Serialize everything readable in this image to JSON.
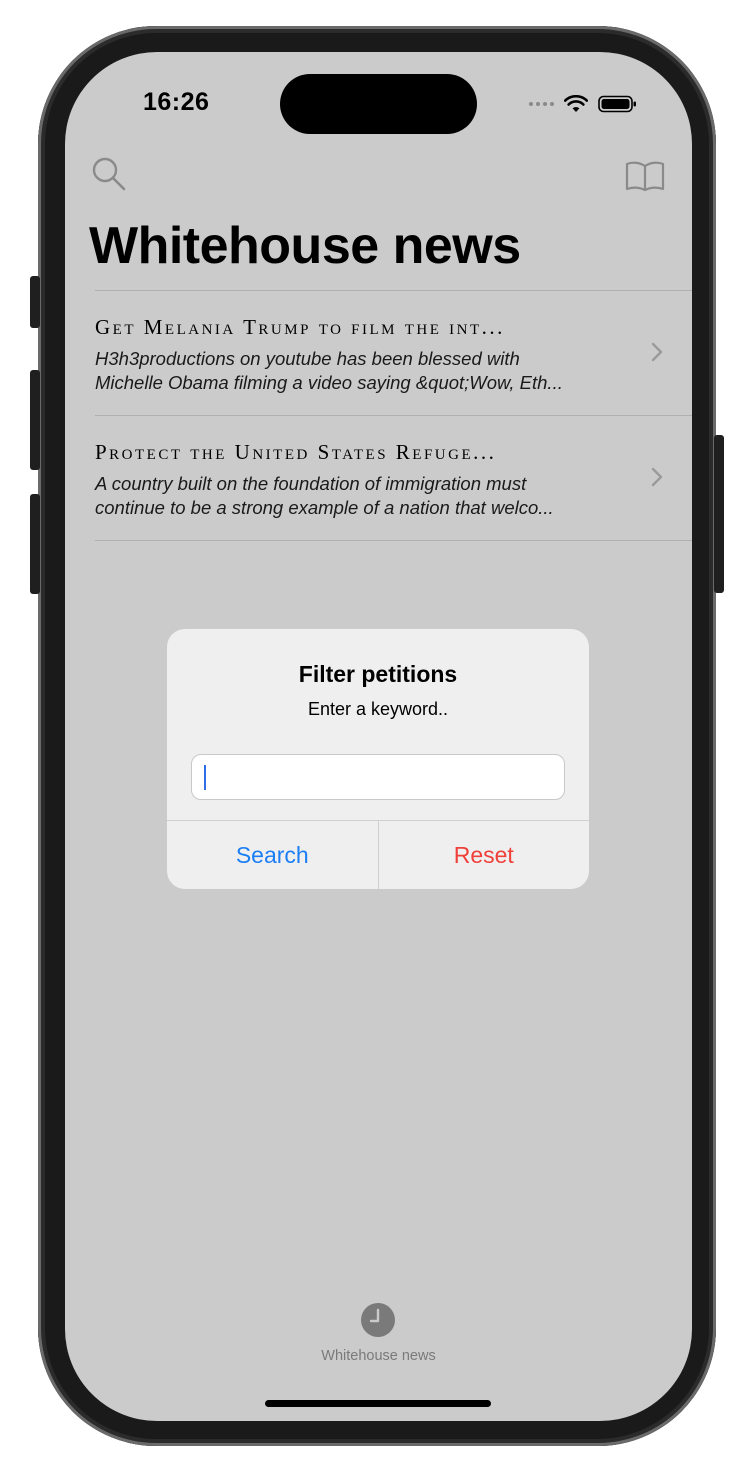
{
  "status_bar": {
    "time": "16:26"
  },
  "nav": {
    "left_icon": "search-icon",
    "right_icon": "book-icon",
    "title": "Whitehouse news"
  },
  "petitions": [
    {
      "title": "Get Melania Trump to film the int...",
      "body_line1": "H3h3productions on youtube has been blessed with",
      "body_line2": "Michelle Obama filming a video saying &quot;Wow, Eth..."
    },
    {
      "title": "Protect the United States Refuge...",
      "body_line1": "A country built on the foundation of immigration must",
      "body_line2": "continue to be a strong example of a nation that welco..."
    }
  ],
  "dialog": {
    "title": "Filter petitions",
    "message": "Enter a keyword..",
    "input_value": "",
    "search_label": "Search",
    "reset_label": "Reset"
  },
  "tab_bar": {
    "items": [
      {
        "label": "Whitehouse news",
        "icon": "clock-icon"
      }
    ]
  },
  "colors": {
    "accent": "#1b7ef4",
    "destructive": "#f0403a",
    "background_dimmed": "#cbcbcb"
  }
}
